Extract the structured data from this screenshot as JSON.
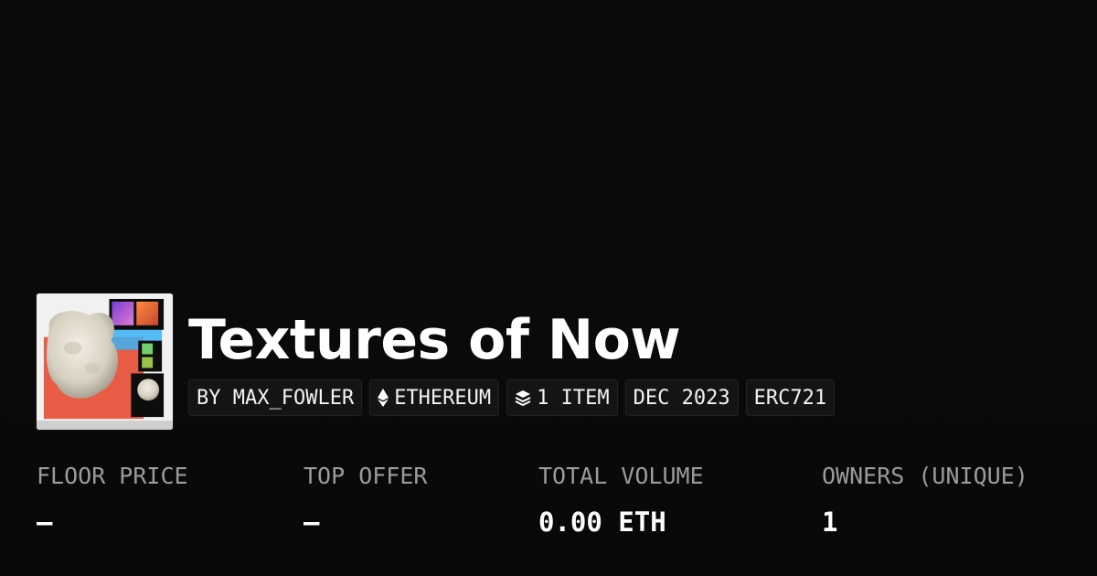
{
  "collection": {
    "title": "Textures of Now",
    "thumbnail_icon": "nft-collection-thumbnail"
  },
  "chips": [
    {
      "label": "BY MAX_FOWLER",
      "icon": null
    },
    {
      "label": "ETHEREUM",
      "icon": "ethereum-icon"
    },
    {
      "label": "1 ITEM",
      "icon": "layers-icon"
    },
    {
      "label": "DEC 2023",
      "icon": null
    },
    {
      "label": "ERC721",
      "icon": null
    }
  ],
  "stats": [
    {
      "label": "FLOOR PRICE",
      "value": "—"
    },
    {
      "label": "TOP OFFER",
      "value": "—"
    },
    {
      "label": "TOTAL VOLUME",
      "value": "0.00 ETH"
    },
    {
      "label": "OWNERS (UNIQUE)",
      "value": "1"
    }
  ],
  "colors": {
    "background": "#0b0b0b",
    "chip_background": "#141414",
    "label": "#9b9b9b",
    "text": "#ffffff"
  }
}
